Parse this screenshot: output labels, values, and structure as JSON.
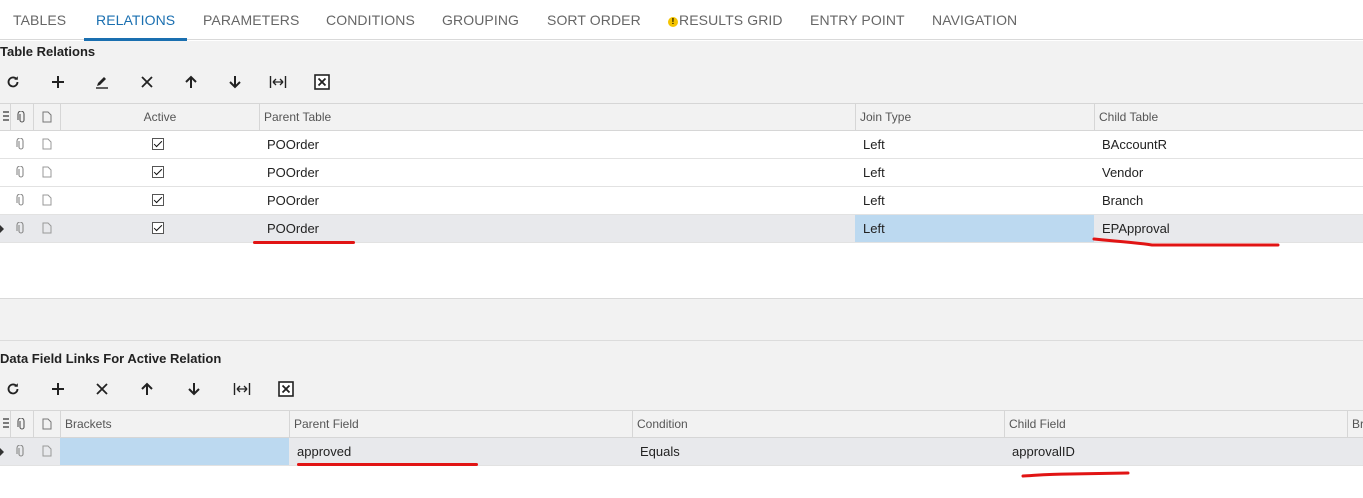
{
  "tabs": [
    {
      "label": "TABLES",
      "active": false,
      "warning": false
    },
    {
      "label": "RELATIONS",
      "active": true,
      "warning": false
    },
    {
      "label": "PARAMETERS",
      "active": false,
      "warning": false
    },
    {
      "label": "CONDITIONS",
      "active": false,
      "warning": false
    },
    {
      "label": "GROUPING",
      "active": false,
      "warning": false
    },
    {
      "label": "SORT ORDER",
      "active": false,
      "warning": false
    },
    {
      "label": "RESULTS GRID",
      "active": false,
      "warning": true
    },
    {
      "label": "ENTRY POINT",
      "active": false,
      "warning": false
    },
    {
      "label": "NAVIGATION",
      "active": false,
      "warning": false
    }
  ],
  "warning_glyph": "!",
  "relations": {
    "title": "Table Relations",
    "toolbar": [
      "refresh-icon",
      "add-icon",
      "edit-icon",
      "delete-icon",
      "move-up-icon",
      "move-down-icon",
      "fit-columns-icon",
      "export-excel-icon"
    ],
    "columns": {
      "active": "Active",
      "parent_table": "Parent Table",
      "join_type": "Join Type",
      "child_table": "Child Table"
    },
    "rows": [
      {
        "active": true,
        "parent_table": "POOrder",
        "join_type": "Left",
        "child_table": "BAccountR",
        "selected": false
      },
      {
        "active": true,
        "parent_table": "POOrder",
        "join_type": "Left",
        "child_table": "Vendor",
        "selected": false
      },
      {
        "active": true,
        "parent_table": "POOrder",
        "join_type": "Left",
        "child_table": "Branch",
        "selected": false
      },
      {
        "active": true,
        "parent_table": "POOrder",
        "join_type": "Left",
        "child_table": "EPApproval",
        "selected": true
      }
    ]
  },
  "links": {
    "title": "Data Field Links For Active Relation",
    "toolbar": [
      "refresh-icon",
      "add-icon",
      "delete-icon",
      "move-up-icon",
      "move-down-icon",
      "fit-columns-icon",
      "export-excel-icon"
    ],
    "columns": {
      "brackets": "Brackets",
      "parent_field": "Parent Field",
      "condition": "Condition",
      "child_field": "Child Field",
      "brackets_close": "Br"
    },
    "rows": [
      {
        "brackets": "",
        "parent_field": "approved",
        "condition": "Equals",
        "child_field": "approvalID",
        "selected": true
      }
    ]
  },
  "colors": {
    "accent": "#1a6fb0",
    "selected_row": "#e8e9ec",
    "highlight_cell": "#bcd9f0",
    "annotation": "#e11414",
    "warning": "#f5c400"
  }
}
